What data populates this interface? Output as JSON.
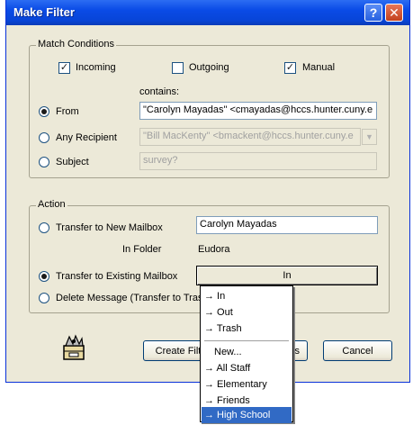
{
  "window": {
    "title": "Make Filter"
  },
  "titlebar": {
    "help_icon": "?",
    "close_icon": "✕"
  },
  "match": {
    "group_label": "Match Conditions",
    "incoming": {
      "label": "Incoming",
      "checked": true
    },
    "outgoing": {
      "label": "Outgoing",
      "checked": false
    },
    "manual": {
      "label": "Manual",
      "checked": true
    },
    "contains_label": "contains:",
    "from": {
      "label": "From",
      "selected": true,
      "value": "\"Carolyn Mayadas\" <cmayadas@hccs.hunter.cuny.e"
    },
    "any_recipient": {
      "label": "Any Recipient",
      "selected": false,
      "value": "\"Bill MacKenty\" <bmackent@hccs.hunter.cuny.e"
    },
    "subject": {
      "label": "Subject",
      "selected": false,
      "value": "survey?"
    }
  },
  "action": {
    "group_label": "Action",
    "transfer_new": {
      "label": "Transfer to New Mailbox",
      "value": "Carolyn Mayadas"
    },
    "in_folder_label": "In Folder",
    "in_folder_value": "Eudora",
    "transfer_existing": {
      "label": "Transfer to Existing Mailbox",
      "selected": true,
      "mailbox_button": "In"
    },
    "delete": {
      "label": "Delete Message (Transfer to Tras"
    }
  },
  "buttons": {
    "create_filter": "Create Filt",
    "hidden_partial": "s",
    "cancel": "Cancel"
  },
  "dropdown": {
    "items": [
      "→ In",
      "→ Out",
      "→ Trash",
      "New...",
      "→ All Staff",
      "→ Elementary",
      "→ Friends",
      "→ High School"
    ],
    "selected": "→ High School"
  }
}
